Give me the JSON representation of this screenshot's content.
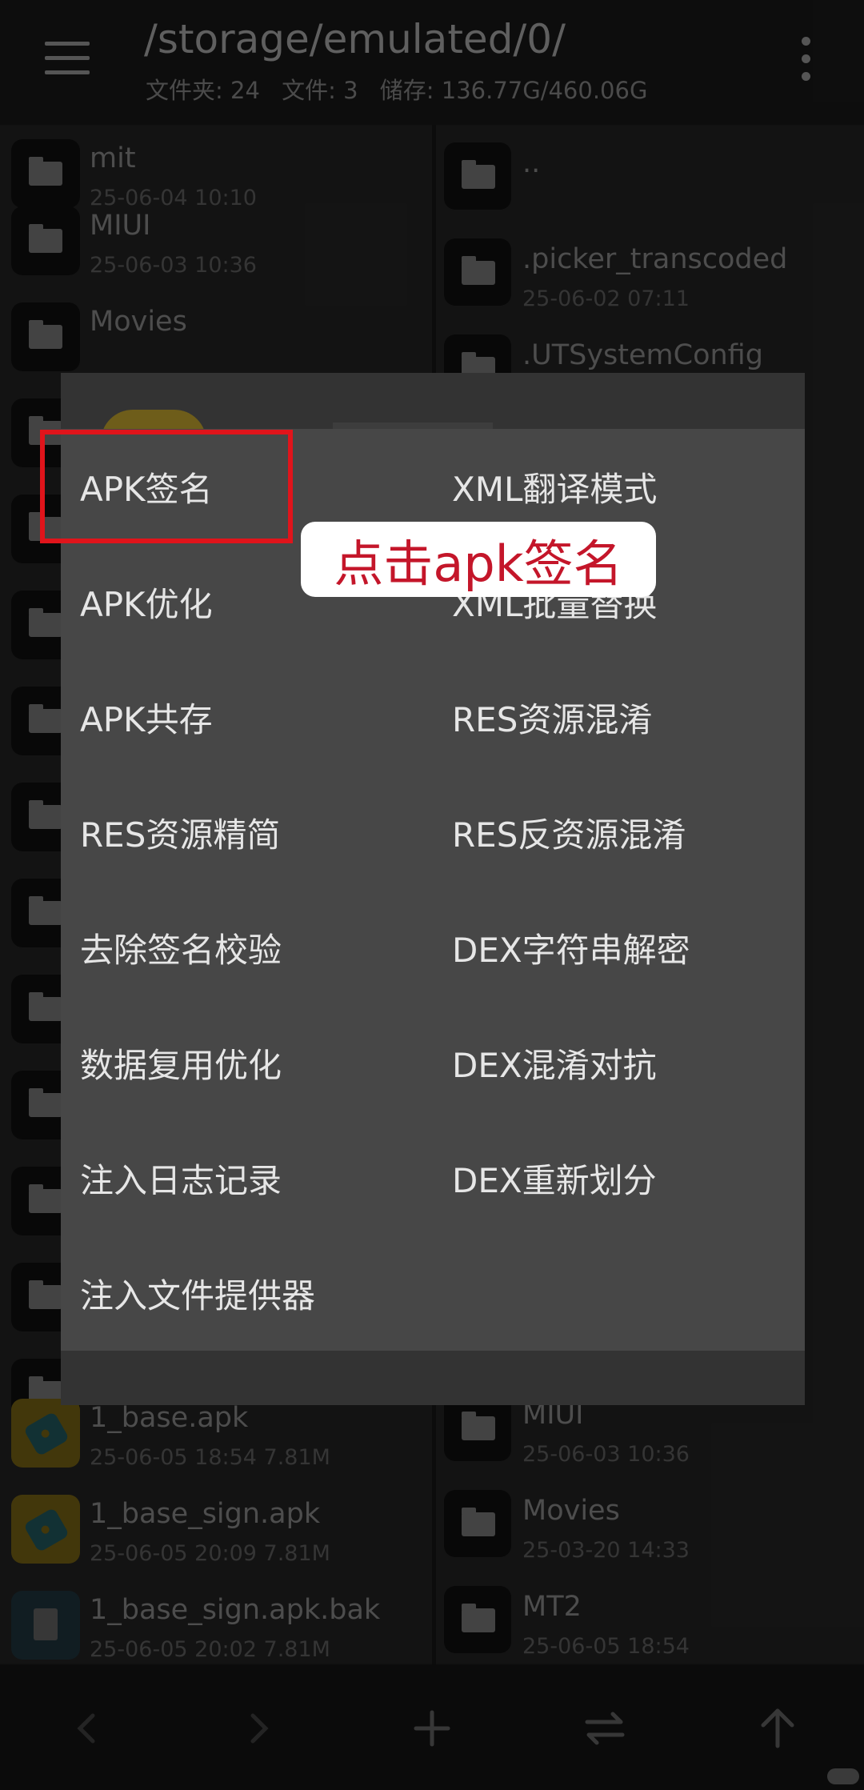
{
  "header": {
    "path": "/storage/emulated/0/",
    "folders": "文件夹: 24",
    "files": "文件: 3",
    "storage": "储存: 136.77G/460.06G"
  },
  "left_pane": {
    "items": [
      {
        "name": "mit",
        "meta": "25-06-04 10:10",
        "type": "folder"
      },
      {
        "name": "MIUI",
        "meta": "25-06-03 10:36",
        "type": "folder"
      },
      {
        "name": "Movies",
        "meta": "",
        "type": "folder"
      },
      {
        "name": "",
        "meta": "",
        "type": "folder"
      },
      {
        "name": "",
        "meta": "",
        "type": "folder"
      },
      {
        "name": "",
        "meta": "",
        "type": "folder"
      },
      {
        "name": "",
        "meta": "",
        "type": "folder"
      },
      {
        "name": "",
        "meta": "",
        "type": "folder"
      },
      {
        "name": "",
        "meta": "",
        "type": "folder"
      },
      {
        "name": "",
        "meta": "",
        "type": "folder"
      },
      {
        "name": "",
        "meta": "",
        "type": "folder"
      },
      {
        "name": "",
        "meta": "",
        "type": "folder"
      },
      {
        "name": "",
        "meta": "",
        "type": "folder"
      },
      {
        "name": "",
        "meta": "",
        "type": "folder"
      },
      {
        "name": "1_base.apk",
        "meta": "25-06-05 18:54  7.81M",
        "type": "apk"
      },
      {
        "name": "1_base_sign.apk",
        "meta": "25-06-05 20:09  7.81M",
        "type": "apk"
      },
      {
        "name": "1_base_sign.apk.bak",
        "meta": "25-06-05 20:02  7.81M",
        "type": "doc"
      }
    ]
  },
  "right_pane": {
    "items": [
      {
        "name": "..",
        "meta": "",
        "type": "folder"
      },
      {
        "name": ".picker_transcoded",
        "meta": "25-06-02 07:11",
        "type": "folder"
      },
      {
        "name": ".UTSystemConfig",
        "meta": "",
        "type": "folder"
      },
      {
        "name": "MIUI",
        "meta": "25-06-03 10:36",
        "type": "folder"
      },
      {
        "name": "Movies",
        "meta": "25-03-20 14:33",
        "type": "folder"
      },
      {
        "name": "MT2",
        "meta": "25-06-05 18:54",
        "type": "folder"
      }
    ]
  },
  "dialog": {
    "left": [
      "APK签名",
      "APK优化",
      "APK共存",
      "RES资源精简",
      "去除签名校验",
      "数据复用优化",
      "注入日志记录",
      "注入文件提供器"
    ],
    "right": [
      "XML翻译模式",
      "XML批量替换",
      "RES资源混淆",
      "RES反资源混淆",
      "DEX字符串解密",
      "DEX混淆对抗",
      "DEX重新划分"
    ]
  },
  "annotation": {
    "callout": "点击apk签名",
    "highlight_color": "#e0141b"
  },
  "bottom_bar": {
    "icons": [
      "chevron-left-icon",
      "chevron-right-icon",
      "plus-icon",
      "swap-icon",
      "arrow-up-icon"
    ]
  }
}
